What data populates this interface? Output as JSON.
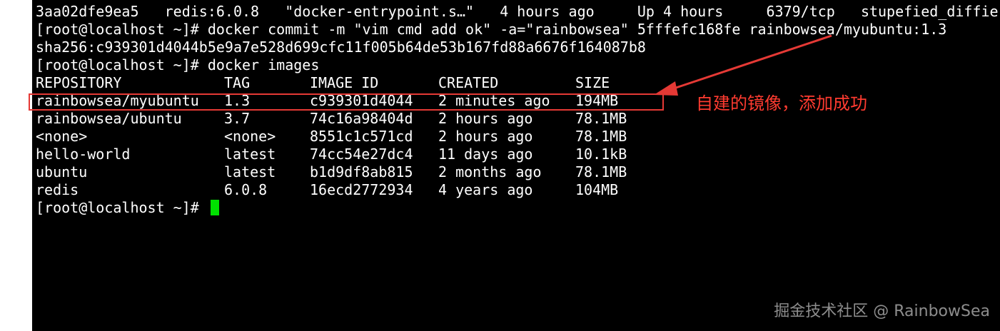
{
  "terminal": {
    "lines_before": [
      "3aa02dfe9ea5   redis:6.0.8   \"docker-entrypoint.s…\"   4 hours ago     Up 4 hours     6379/tcp   stupefied_diffie",
      "[root@localhost ~]# docker commit -m \"vim cmd add ok\" -a=\"rainbowsea\" 5fffefc168fe rainbowsea/myubuntu:1.3",
      "sha256:c939301d4044b5e9a7e528d699cfc11f005b64de53b167fd88a6676f164087b8",
      "[root@localhost ~]# docker images"
    ],
    "table": {
      "headers": {
        "repository": "REPOSITORY",
        "tag": "TAG",
        "image_id": "IMAGE ID",
        "created": "CREATED",
        "size": "SIZE"
      },
      "rows": [
        {
          "repository": "rainbowsea/myubuntu",
          "tag": "1.3",
          "image_id": "c939301d4044",
          "created": "2 minutes ago",
          "size": "194MB"
        },
        {
          "repository": "rainbowsea/ubuntu",
          "tag": "3.7",
          "image_id": "74c16a98404d",
          "created": "2 hours ago",
          "size": "78.1MB"
        },
        {
          "repository": "<none>",
          "tag": "<none>",
          "image_id": "8551c1c571cd",
          "created": "2 hours ago",
          "size": "78.1MB"
        },
        {
          "repository": "hello-world",
          "tag": "latest",
          "image_id": "74cc54e27dc4",
          "created": "11 days ago",
          "size": "10.1kB"
        },
        {
          "repository": "ubuntu",
          "tag": "latest",
          "image_id": "b1d9df8ab815",
          "created": "2 months ago",
          "size": "78.1MB"
        },
        {
          "repository": "redis",
          "tag": "6.0.8",
          "image_id": "16ecd2772934",
          "created": "4 years ago",
          "size": "104MB"
        }
      ]
    },
    "prompt": "[root@localhost ~]# "
  },
  "annotation": {
    "text": "自建的镜像，添加成功",
    "color": "#ff3b30"
  },
  "watermark": {
    "text": "掘金技术社区 @ RainbowSea"
  },
  "colors": {
    "terminal_bg": "#000000",
    "terminal_fg": "#ffffff",
    "cursor": "#00e000",
    "highlight": "#e53935"
  }
}
